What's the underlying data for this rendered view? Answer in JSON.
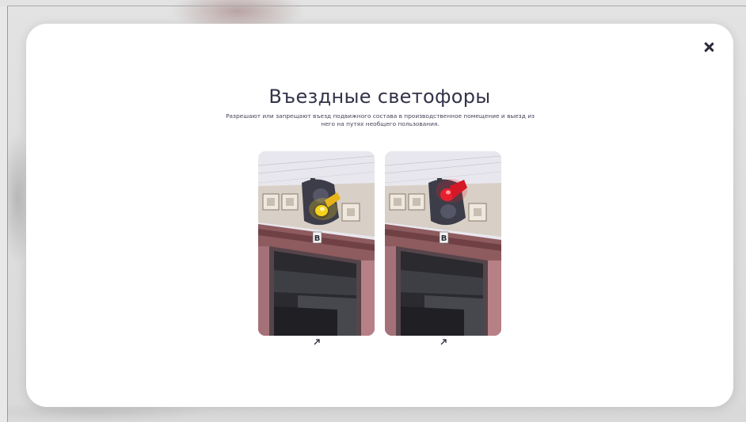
{
  "modal": {
    "title": "Въездные светофоры",
    "subtitle": "Разрешают или запрещают въезд подвижного состава в производственное помещение и выезд из него на путях необщего пользования.",
    "close_icon": "close-icon"
  },
  "cards": [
    {
      "signal_color": "yellow",
      "gate_letter": "В",
      "expand_icon": "arrow-up-right-icon"
    },
    {
      "signal_color": "red",
      "gate_letter": "В",
      "expand_icon": "arrow-up-right-icon"
    }
  ],
  "colors": {
    "yellow_light": "#f6d21e",
    "red_light": "#e8202e",
    "title": "#33334a"
  }
}
